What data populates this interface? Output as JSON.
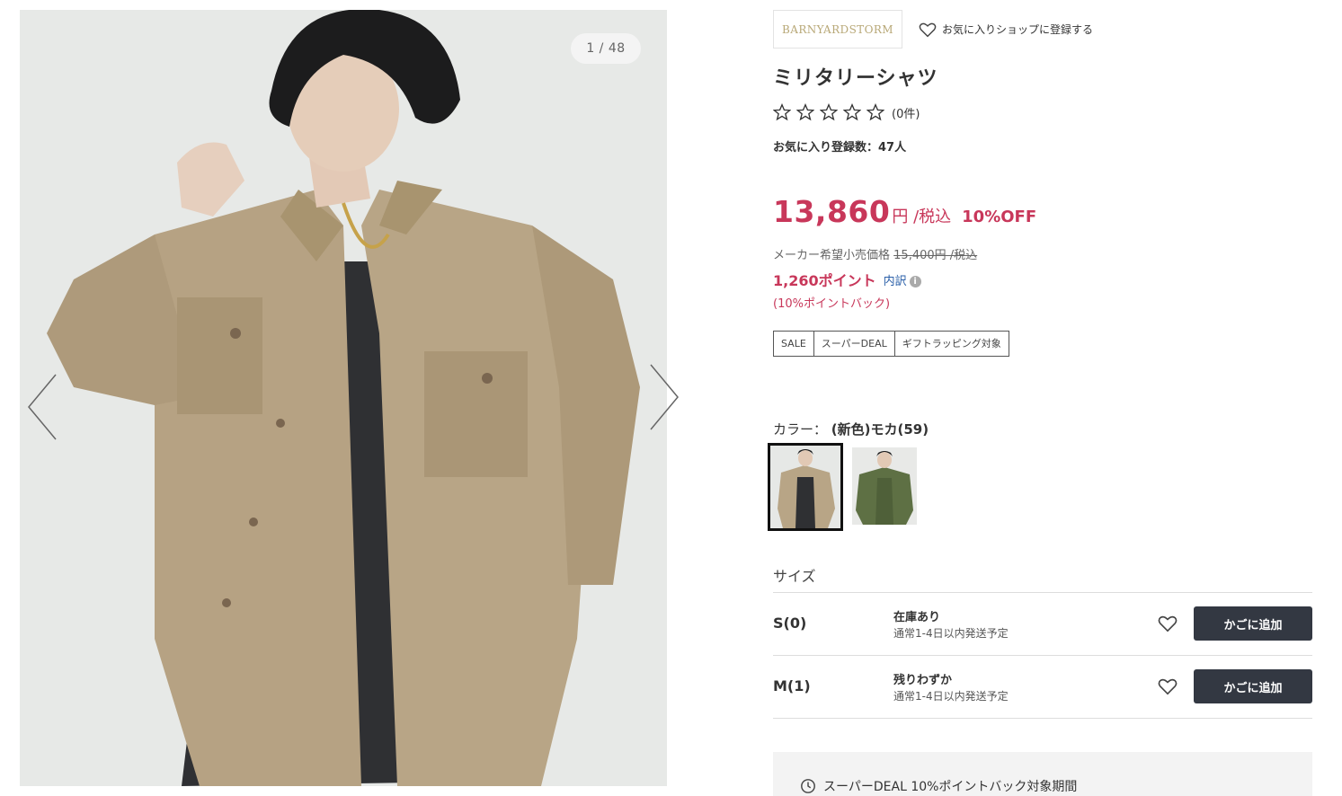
{
  "gallery": {
    "counter": "1 / 48",
    "main_image": "model-wearing-military-shirt-mocha"
  },
  "brand": {
    "logo_text": "BARNYARDSTORM",
    "fav_shop_label": "お気に入りショップに登録する"
  },
  "product": {
    "title": "ミリタリーシャツ",
    "rating": 0,
    "rating_count": "(0件)",
    "fav_count_label": "お気に入り登録数：",
    "fav_count_value": "47人"
  },
  "pricing": {
    "price": "13,860",
    "price_unit": "円 /税込",
    "discount": "10%OFF",
    "list_price_label": "メーカー希望小売価格",
    "list_price_value": "15,400円 /税込",
    "points_value": "1,260ポイント",
    "breakdown_label": "内訳",
    "pointback": "(10%ポイントバック)"
  },
  "tags": [
    "SALE",
    "スーパーDEAL",
    "ギフトラッピング対象"
  ],
  "color": {
    "label": "カラー：",
    "selected": "(新色)モカ(59)",
    "swatches": [
      "mocha",
      "khaki-green"
    ]
  },
  "size": {
    "title": "サイズ",
    "rows": [
      {
        "name": "S(0)",
        "stock": "在庫あり",
        "ship": "通常1-4日以内発送予定",
        "cart_label": "かごに追加"
      },
      {
        "name": "M(1)",
        "stock": "残りわずか",
        "ship": "通常1-4日以内発送予定",
        "cart_label": "かごに追加"
      }
    ]
  },
  "deal": {
    "text": "スーパーDEAL 10%ポイントバック対象期間"
  },
  "colors": {
    "price_accent": "#c8375a",
    "link": "#2a5fa8",
    "button": "#333842"
  }
}
